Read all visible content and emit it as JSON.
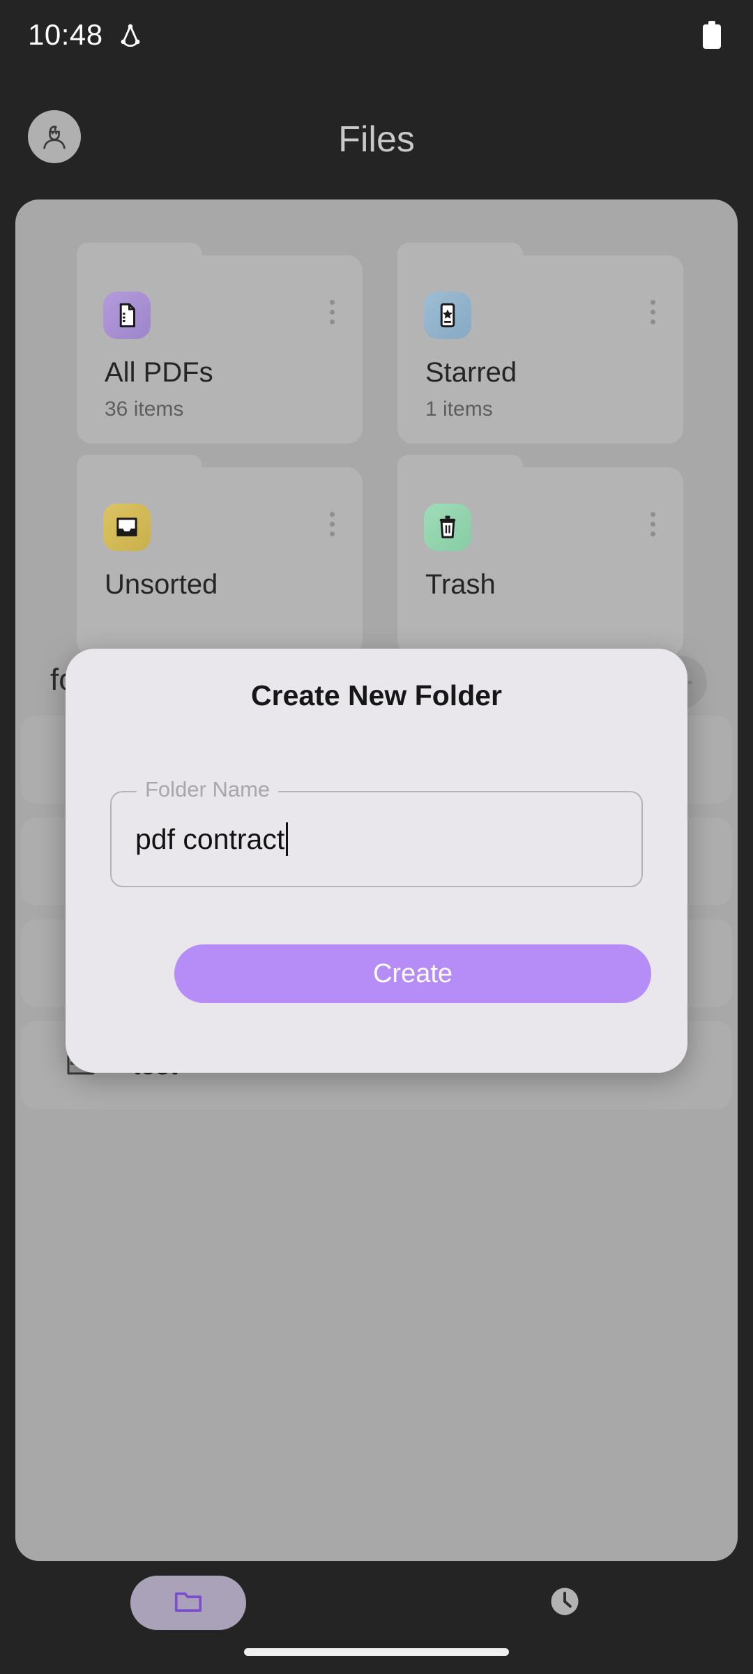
{
  "status_bar": {
    "time": "10:48",
    "cast_icon": "cast-sync-icon",
    "battery_icon": "battery-full-icon"
  },
  "header": {
    "title": "Files",
    "avatar_icon": "user-avatar-icon"
  },
  "folders": [
    {
      "name": "All PDFs",
      "count": "36 items",
      "icon": "pdf-document-icon",
      "icon_bg": "#A98FD4"
    },
    {
      "name": "Starred",
      "count": "1 items",
      "icon": "star-document-icon",
      "icon_bg": "#95B8D0"
    },
    {
      "name": "Unsorted",
      "count": "",
      "icon": "inbox-tray-icon",
      "icon_bg": "#D4BC57"
    },
    {
      "name": "Trash",
      "count": "",
      "icon": "trash-can-icon",
      "icon_bg": "#94D6B0"
    }
  ],
  "section": {
    "label": "folders",
    "action_icon": "sort-filter-icon"
  },
  "list_items": [
    {
      "label": "",
      "icon": "folder-icon"
    },
    {
      "label": "",
      "icon": "folder-icon"
    },
    {
      "label": "",
      "icon": "folder-icon"
    },
    {
      "label": "test",
      "icon": "folder-icon"
    }
  ],
  "dialog": {
    "title": "Create New Folder",
    "field_label": "Folder Name",
    "field_value": "pdf contract",
    "field_placeholder": "Folder Name",
    "create_label": "Create"
  },
  "bottom_nav": {
    "items": [
      {
        "name": "files",
        "icon": "folder-icon",
        "active": true
      },
      {
        "name": "recent",
        "icon": "clock-icon",
        "active": false
      }
    ]
  },
  "colors": {
    "accent": "#B68DF7",
    "dialog_bg": "#E9E7EB",
    "scrim_content": "#A8A8A8",
    "app_bg": "#242424"
  }
}
